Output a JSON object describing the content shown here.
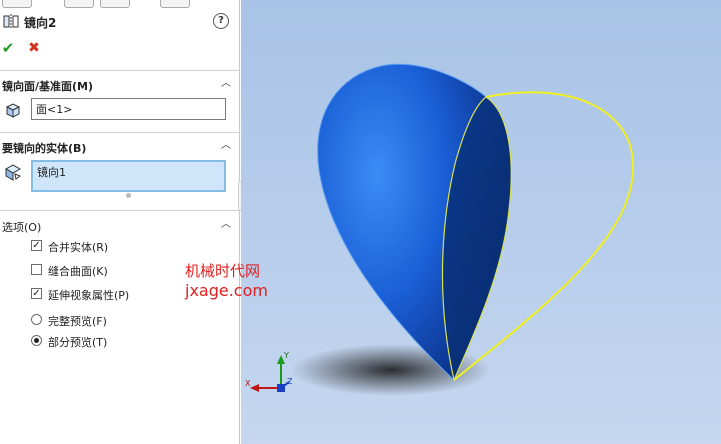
{
  "panel": {
    "feature_title": "镜向2",
    "help_symbol": "?",
    "ok_symbol": "✔",
    "cancel_symbol": "✖",
    "mirror_face": {
      "title": "镜向面/基准面(M)",
      "value": "面<1>"
    },
    "bodies_to_mirror": {
      "title": "要镜向的实体(B)",
      "value": "镜向1"
    },
    "options": {
      "title": "选项(O)",
      "items": [
        {
          "label": "合并实体(R)",
          "kind": "checkbox",
          "checked": true
        },
        {
          "label": "缝合曲面(K)",
          "kind": "checkbox",
          "checked": false
        },
        {
          "label": "延伸视象属性(P)",
          "kind": "checkbox",
          "checked": true
        },
        {
          "label": "完整预览(F)",
          "kind": "radio",
          "checked": false
        },
        {
          "label": "部分预览(T)",
          "kind": "radio",
          "checked": true
        }
      ]
    },
    "caret_symbol": "︿"
  },
  "viewport": {
    "watermark_cn": "机械时代网",
    "watermark_en": "jxage.com",
    "model_color": "#1a5fd6",
    "preview_color": "#f0f020",
    "background": "#adc6e8"
  },
  "triad": {
    "x_label": "X",
    "y_label": "Y",
    "z_label": "Z"
  }
}
